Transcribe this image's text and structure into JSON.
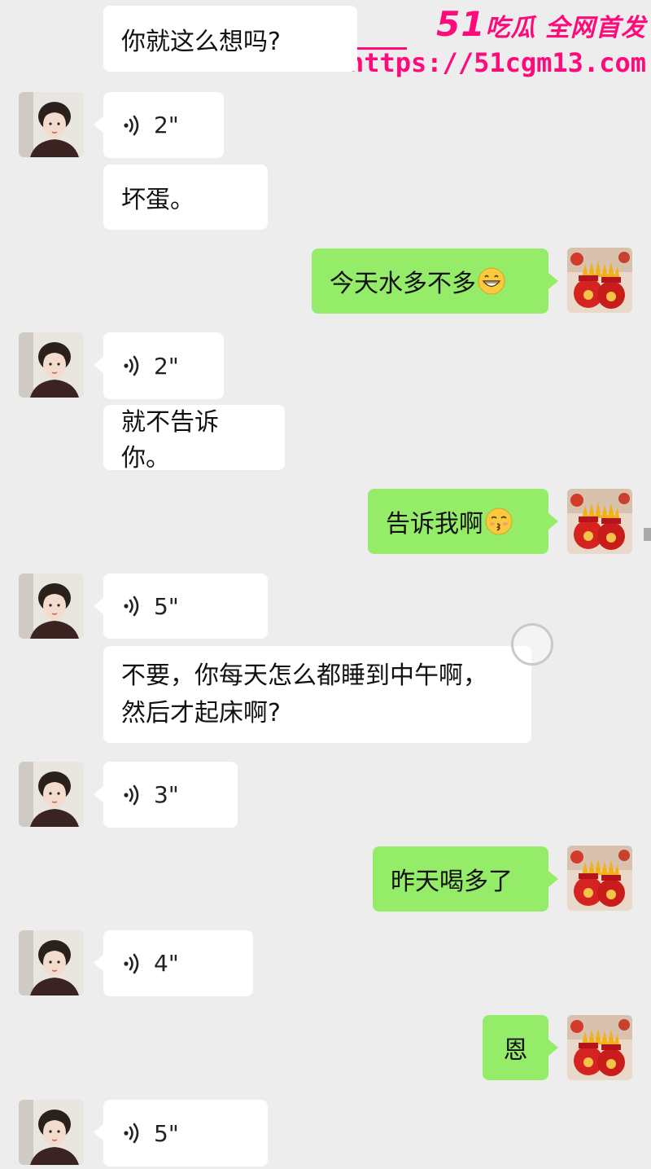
{
  "watermark": {
    "brand_num": "51",
    "brand_text": "吃瓜 全网首发",
    "url": "https://51cgm13.com"
  },
  "messages": [
    {
      "id": "m0",
      "side": "left",
      "type": "text",
      "text": "你就这么想吗?"
    },
    {
      "id": "m1",
      "side": "left",
      "type": "voice",
      "duration": "2\""
    },
    {
      "id": "m2",
      "side": "left",
      "type": "text",
      "text": "坏蛋。"
    },
    {
      "id": "m3",
      "side": "right",
      "type": "text",
      "text": "今天水多不多",
      "emoji": "grin-emoji"
    },
    {
      "id": "m4",
      "side": "left",
      "type": "voice",
      "duration": "2\""
    },
    {
      "id": "m5",
      "side": "left",
      "type": "text",
      "text": "就不告诉你。"
    },
    {
      "id": "m6",
      "side": "right",
      "type": "text",
      "text": "告诉我啊",
      "emoji": "kiss-emoji"
    },
    {
      "id": "m7",
      "side": "left",
      "type": "voice",
      "duration": "5\""
    },
    {
      "id": "m8",
      "side": "left",
      "type": "text",
      "lines": [
        "不要，你每天怎么都睡到中午啊，",
        "然后才起床啊?"
      ]
    },
    {
      "id": "m9",
      "side": "left",
      "type": "voice",
      "duration": "3\""
    },
    {
      "id": "m10",
      "side": "right",
      "type": "text",
      "text": "昨天喝多了"
    },
    {
      "id": "m11",
      "side": "left",
      "type": "voice",
      "duration": "4\""
    },
    {
      "id": "m12",
      "side": "right",
      "type": "text",
      "text": "恩"
    },
    {
      "id": "m13",
      "side": "left",
      "type": "voice",
      "duration": "5\""
    }
  ],
  "colors": {
    "background": "#ededed",
    "bubble_left": "#ffffff",
    "bubble_right": "#95ec69",
    "watermark": "#ff0a7a"
  }
}
